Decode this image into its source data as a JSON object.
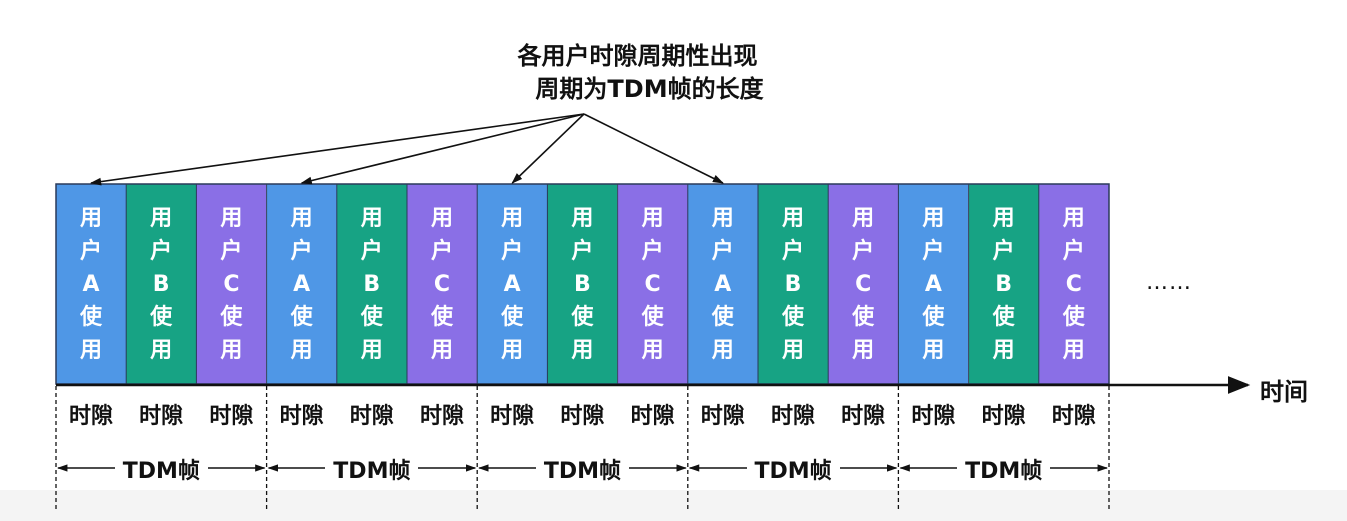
{
  "title": {
    "line1": "各用户时隙周期性出现",
    "line2": "周期为TDM帧的长度"
  },
  "users": [
    {
      "label": [
        "用",
        "户",
        "A",
        "使",
        "用"
      ],
      "color": "#4f97e6"
    },
    {
      "label": [
        "用",
        "户",
        "B",
        "使",
        "用"
      ],
      "color": "#17a384"
    },
    {
      "label": [
        "用",
        "户",
        "C",
        "使",
        "用"
      ],
      "color": "#8a6fe6"
    }
  ],
  "frame_count": 5,
  "slot_label": "时隙",
  "frame_label": "TDM帧",
  "ellipsis": "……",
  "time_axis_label": "时间",
  "colors": {
    "border": "#2a3a5a",
    "arrow": "#111111"
  }
}
